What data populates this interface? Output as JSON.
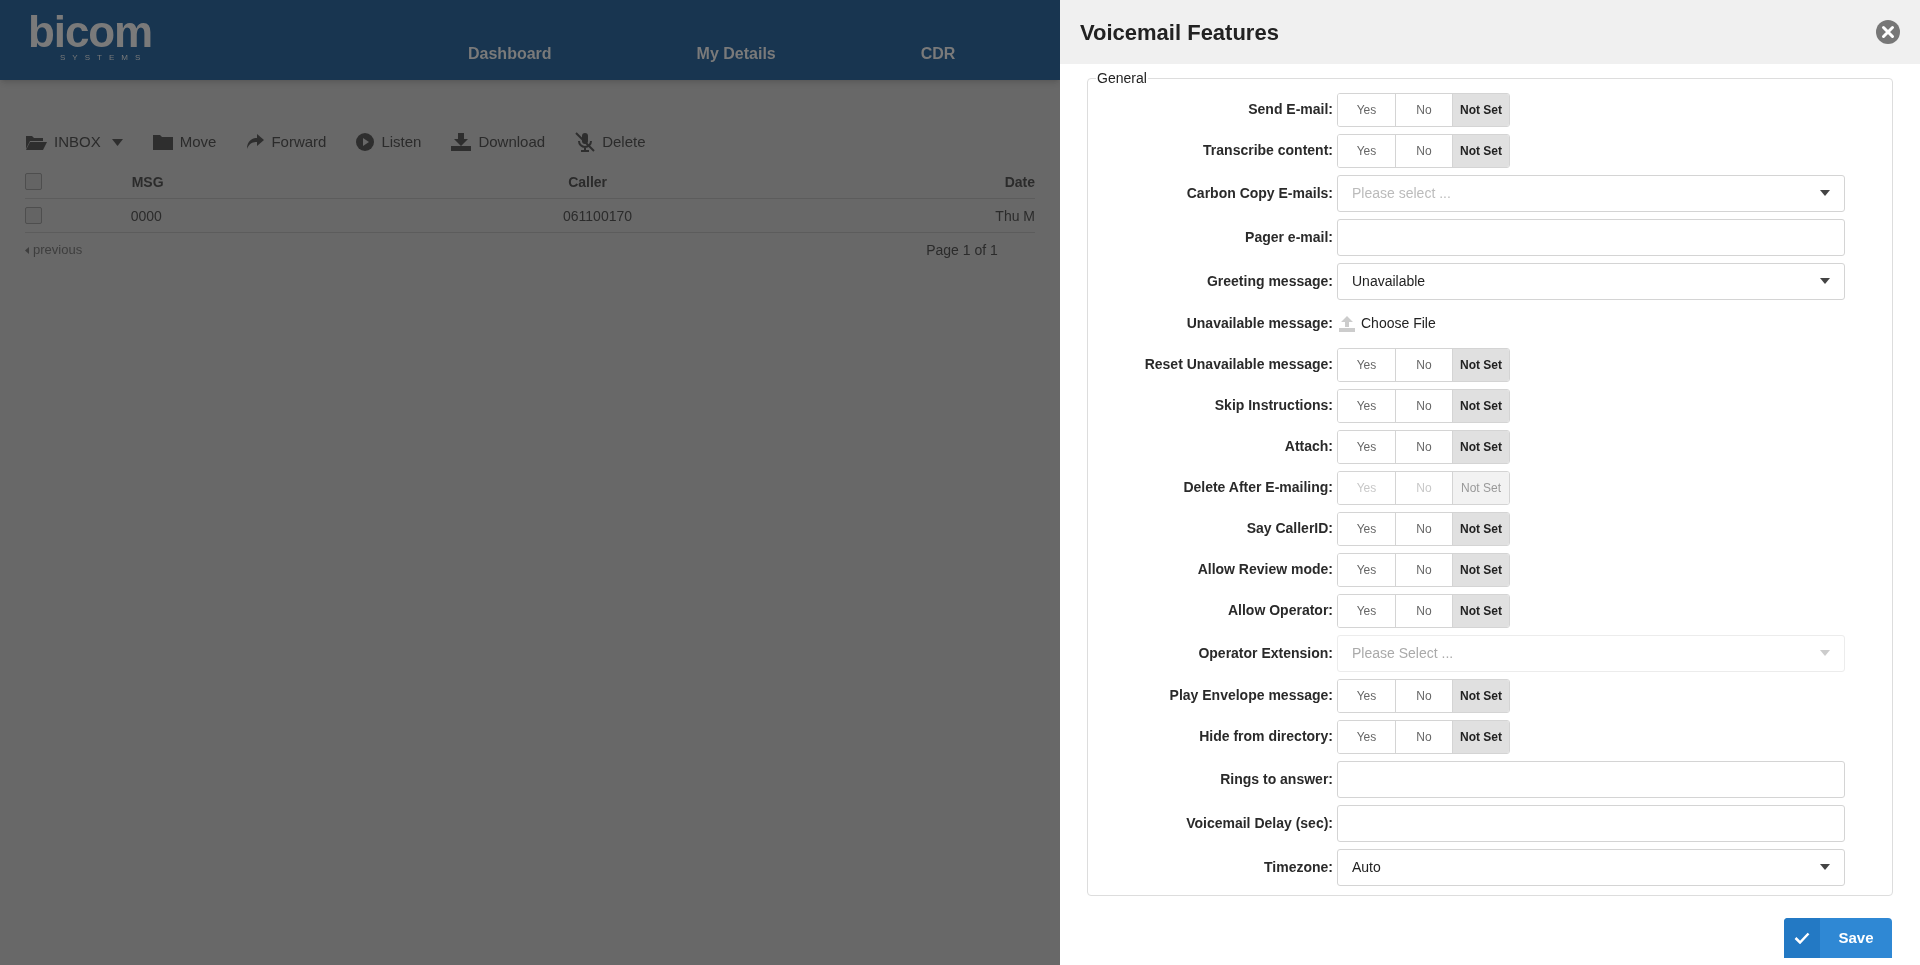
{
  "header": {
    "logo": "bicom",
    "logo_sub": "SYSTEMS",
    "nav": [
      {
        "label": "Dashboard"
      },
      {
        "label": "My Details"
      },
      {
        "label": "CDR"
      }
    ]
  },
  "toolbar": [
    {
      "label": "INBOX",
      "dropdown": true
    },
    {
      "label": "Move",
      "dropdown": false
    },
    {
      "label": "Forward",
      "dropdown": false
    },
    {
      "label": "Listen",
      "dropdown": false
    },
    {
      "label": "Download",
      "dropdown": false
    },
    {
      "label": "Delete",
      "dropdown": false
    }
  ],
  "table": {
    "select_all": {
      "checked": false
    },
    "columns": [
      "MSG",
      "Caller",
      "Date"
    ],
    "rows": [
      {
        "checked": false,
        "cells": [
          "0000",
          "061100170",
          "Thu M"
        ]
      }
    ]
  },
  "pagination": {
    "previous": "previous",
    "page": "Page 1 of 1"
  },
  "panel": {
    "title": "Voicemail Features",
    "legend": "General",
    "rows": [
      {
        "kind": "toggle",
        "label": "Send E-mail:",
        "disabled": false,
        "options": [
          {
            "label": "Yes",
            "selected": false
          },
          {
            "label": "No",
            "selected": false
          },
          {
            "label": "Not Set",
            "selected": true
          }
        ]
      },
      {
        "kind": "toggle",
        "label": "Transcribe content:",
        "disabled": false,
        "options": [
          {
            "label": "Yes",
            "selected": false
          },
          {
            "label": "No",
            "selected": false
          },
          {
            "label": "Not Set",
            "selected": true
          }
        ]
      },
      {
        "kind": "select",
        "label": "Carbon Copy E-mails:",
        "disabled": false,
        "placeholder": "Please select ..."
      },
      {
        "kind": "text",
        "label": "Pager e-mail:"
      },
      {
        "kind": "select",
        "label": "Greeting message:",
        "disabled": false,
        "value": "Unavailable"
      },
      {
        "kind": "file",
        "label": "Unavailable message:",
        "button": "Choose File"
      },
      {
        "kind": "toggle",
        "label": "Reset Unavailable message:",
        "disabled": false,
        "options": [
          {
            "label": "Yes",
            "selected": false
          },
          {
            "label": "No",
            "selected": false
          },
          {
            "label": "Not Set",
            "selected": true
          }
        ]
      },
      {
        "kind": "toggle",
        "label": "Skip Instructions:",
        "disabled": false,
        "options": [
          {
            "label": "Yes",
            "selected": false
          },
          {
            "label": "No",
            "selected": false
          },
          {
            "label": "Not Set",
            "selected": true
          }
        ]
      },
      {
        "kind": "toggle",
        "label": "Attach:",
        "disabled": false,
        "options": [
          {
            "label": "Yes",
            "selected": false
          },
          {
            "label": "No",
            "selected": false
          },
          {
            "label": "Not Set",
            "selected": true
          }
        ]
      },
      {
        "kind": "toggle",
        "label": "Delete After E-mailing:",
        "disabled": true,
        "options": [
          {
            "label": "Yes",
            "selected": false
          },
          {
            "label": "No",
            "selected": false
          },
          {
            "label": "Not Set",
            "selected": true
          }
        ]
      },
      {
        "kind": "toggle",
        "label": "Say CallerID:",
        "disabled": false,
        "options": [
          {
            "label": "Yes",
            "selected": false
          },
          {
            "label": "No",
            "selected": false
          },
          {
            "label": "Not Set",
            "selected": true
          }
        ]
      },
      {
        "kind": "toggle",
        "label": "Allow Review mode:",
        "disabled": false,
        "options": [
          {
            "label": "Yes",
            "selected": false
          },
          {
            "label": "No",
            "selected": false
          },
          {
            "label": "Not Set",
            "selected": true
          }
        ]
      },
      {
        "kind": "toggle",
        "label": "Allow Operator:",
        "disabled": false,
        "options": [
          {
            "label": "Yes",
            "selected": false
          },
          {
            "label": "No",
            "selected": false
          },
          {
            "label": "Not Set",
            "selected": true
          }
        ]
      },
      {
        "kind": "select",
        "label": "Operator Extension:",
        "disabled": true,
        "placeholder": "Please Select ..."
      },
      {
        "kind": "toggle",
        "label": "Play Envelope message:",
        "disabled": false,
        "options": [
          {
            "label": "Yes",
            "selected": false
          },
          {
            "label": "No",
            "selected": false
          },
          {
            "label": "Not Set",
            "selected": true
          }
        ]
      },
      {
        "kind": "toggle",
        "label": "Hide from directory:",
        "disabled": false,
        "options": [
          {
            "label": "Yes",
            "selected": false
          },
          {
            "label": "No",
            "selected": false
          },
          {
            "label": "Not Set",
            "selected": true
          }
        ]
      },
      {
        "kind": "text",
        "label": "Rings to answer:"
      },
      {
        "kind": "text",
        "label": "Voicemail Delay (sec):"
      },
      {
        "kind": "select",
        "label": "Timezone:",
        "disabled": false,
        "value": "Auto"
      }
    ],
    "save": "Save"
  }
}
